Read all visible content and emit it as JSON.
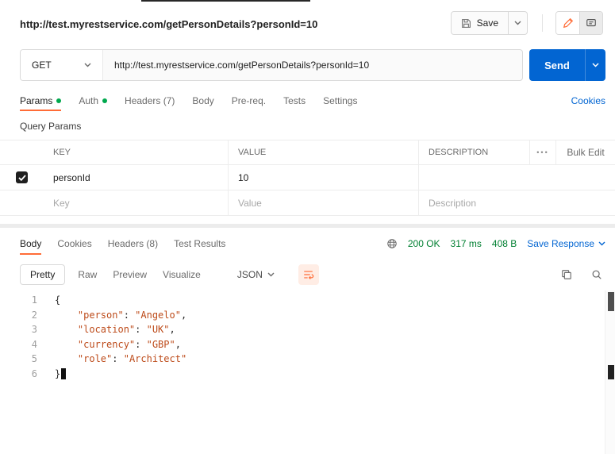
{
  "colors": {
    "accent_orange": "#FF6C37",
    "primary_blue": "#0265D2",
    "success_green": "#007F31",
    "dot_green": "#00A84D",
    "code_string": "#BD4B1A"
  },
  "icons": [
    "save-icon",
    "chevron-down-icon",
    "edit-pencil-icon",
    "comments-icon",
    "globe-icon",
    "wrap-text-icon",
    "copy-icon",
    "search-icon",
    "more-options-icon",
    "checkmark-icon"
  ],
  "header": {
    "title": "http://test.myrestservice.com/getPersonDetails?personId=10",
    "save_button": "Save"
  },
  "request": {
    "method": "GET",
    "url": "http://test.myrestservice.com/getPersonDetails?personId=10",
    "send_button": "Send",
    "tabs": [
      {
        "label": "Params"
      },
      {
        "label": "Auth"
      },
      {
        "label": "Headers (7)"
      },
      {
        "label": "Body"
      },
      {
        "label": "Pre-req."
      },
      {
        "label": "Tests"
      },
      {
        "label": "Settings"
      }
    ],
    "cookies_link": "Cookies"
  },
  "params": {
    "section_label": "Query Params",
    "columns": [
      "KEY",
      "VALUE",
      "DESCRIPTION"
    ],
    "more_options": "•••",
    "bulk_edit": "Bulk Edit",
    "rows": [
      {
        "checked": true,
        "key": "personId",
        "value": "10",
        "description": ""
      }
    ],
    "placeholders": {
      "key": "Key",
      "value": "Value",
      "description": "Description"
    }
  },
  "response": {
    "tabs": [
      {
        "label": "Body"
      },
      {
        "label": "Cookies"
      },
      {
        "label": "Headers (8)"
      },
      {
        "label": "Test Results"
      }
    ],
    "status": "200 OK",
    "time": "317 ms",
    "size": "408 B",
    "save_response": "Save Response",
    "view_modes": [
      "Pretty",
      "Raw",
      "Preview",
      "Visualize"
    ],
    "format": "JSON",
    "body": {
      "lines": [
        {
          "num": "1",
          "tokens": [
            {
              "text": "{",
              "type": "punct"
            }
          ]
        },
        {
          "num": "2",
          "tokens": [
            {
              "text": "    ",
              "type": "ws"
            },
            {
              "text": "\"person\"",
              "type": "string"
            },
            {
              "text": ": ",
              "type": "punct"
            },
            {
              "text": "\"Angelo\"",
              "type": "string"
            },
            {
              "text": ",",
              "type": "punct"
            }
          ]
        },
        {
          "num": "3",
          "tokens": [
            {
              "text": "    ",
              "type": "ws"
            },
            {
              "text": "\"location\"",
              "type": "string"
            },
            {
              "text": ": ",
              "type": "punct"
            },
            {
              "text": "\"UK\"",
              "type": "string"
            },
            {
              "text": ",",
              "type": "punct"
            }
          ]
        },
        {
          "num": "4",
          "tokens": [
            {
              "text": "    ",
              "type": "ws"
            },
            {
              "text": "\"currency\"",
              "type": "string"
            },
            {
              "text": ": ",
              "type": "punct"
            },
            {
              "text": "\"GBP\"",
              "type": "string"
            },
            {
              "text": ",",
              "type": "punct"
            }
          ]
        },
        {
          "num": "5",
          "tokens": [
            {
              "text": "    ",
              "type": "ws"
            },
            {
              "text": "\"role\"",
              "type": "string"
            },
            {
              "text": ": ",
              "type": "punct"
            },
            {
              "text": "\"Architect\"",
              "type": "string"
            }
          ]
        },
        {
          "num": "6",
          "tokens": [
            {
              "text": "}",
              "type": "punct"
            }
          ],
          "caret": true
        }
      ]
    }
  }
}
